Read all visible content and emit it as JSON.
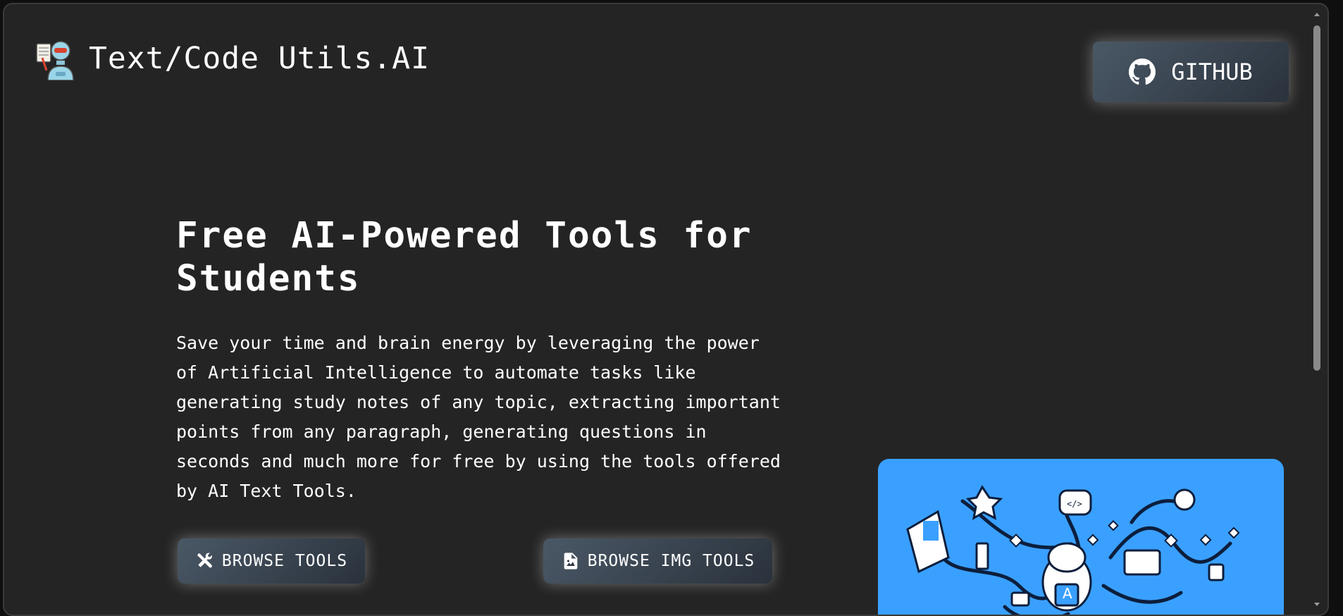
{
  "header": {
    "brand_title": "Text/Code Utils.AI",
    "logo_icon": "robot-logo-icon",
    "github_label": "GITHUB",
    "github_icon": "github-icon"
  },
  "hero": {
    "heading": "Free AI-Powered Tools for Students",
    "description": "Save your time and brain energy by leveraging the power of Artificial Intelligence to automate tasks like generating study notes of any topic, extracting important points from any paragraph, generating questions in seconds and much more for free by using the tools offered by AI Text Tools."
  },
  "actions": {
    "browse_tools_label": "BROWSE TOOLS",
    "browse_tools_icon": "tools-icon",
    "browse_img_tools_label": "BROWSE IMG TOOLS",
    "browse_img_tools_icon": "image-file-icon"
  },
  "illustration": {
    "icon": "ai-robot-illustration",
    "background_color": "#3aa0ff"
  },
  "colors": {
    "page_background": "#242424",
    "text": "#ffffff",
    "button_gradient_start": "#4a5866",
    "button_gradient_end": "#2a323c"
  }
}
